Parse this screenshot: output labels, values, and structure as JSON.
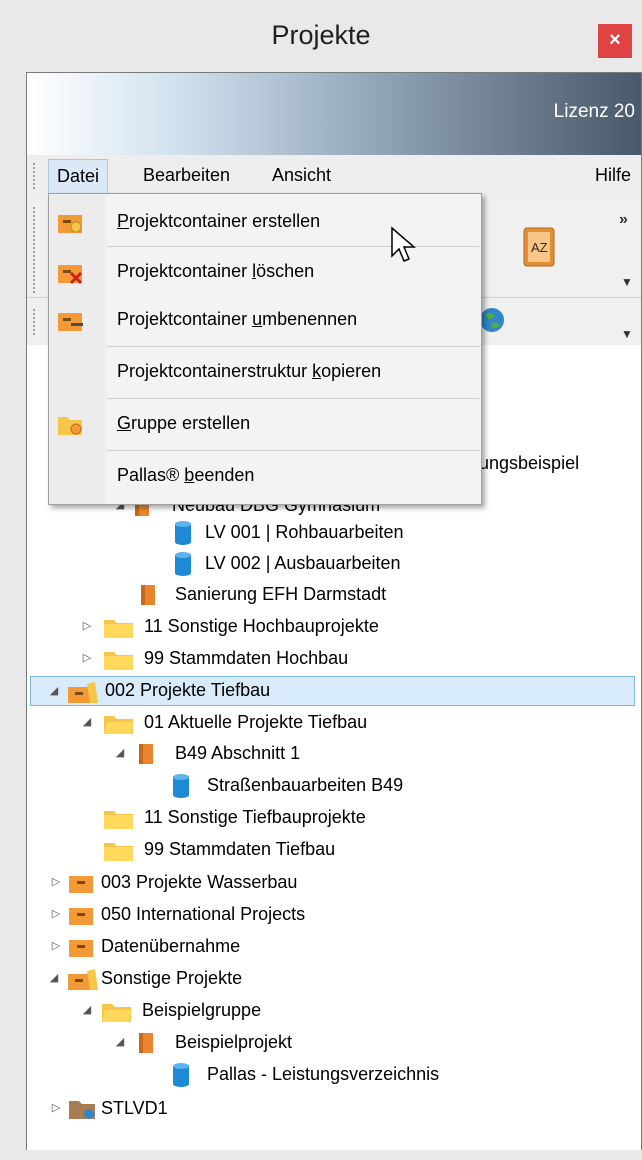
{
  "window": {
    "title": "Projekte",
    "close_label": "×"
  },
  "banner": {
    "license": "Lizenz 20"
  },
  "menubar": {
    "file": "Datei",
    "edit": "Bearbeiten",
    "view": "Ansicht",
    "help": "Hilfe"
  },
  "toolbar": {
    "overflow": "»",
    "az_icon": "AZ"
  },
  "dropdown": {
    "items": [
      {
        "pre": "",
        "u": "P",
        "post": "rojektcontainer erstellen",
        "icon": "folder-add-icon"
      },
      {
        "pre": "Projektcontainer ",
        "u": "l",
        "post": "öschen",
        "icon": "folder-delete-icon"
      },
      {
        "pre": "Projektcontainer ",
        "u": "u",
        "post": "mbenennen",
        "icon": "folder-rename-icon"
      },
      {
        "pre": "Projektcontainerstruktur ",
        "u": "k",
        "post": "opieren",
        "icon": ""
      },
      {
        "pre": "",
        "u": "G",
        "post": "ruppe erstellen",
        "icon": "group-add-icon"
      },
      {
        "pre": "Pallas® ",
        "u": "b",
        "post": "eenden",
        "icon": ""
      }
    ]
  },
  "tree": {
    "partial_right": "ungsbeispiel",
    "partial_row": "Neubau DBG Gymnasium",
    "rows": [
      {
        "label": "LV 001 | Rohbauarbeiten"
      },
      {
        "label": "LV 002 | Ausbauarbeiten"
      },
      {
        "label": "Sanierung EFH Darmstadt"
      },
      {
        "label": "11 Sonstige Hochbauprojekte"
      },
      {
        "label": "99 Stammdaten Hochbau"
      },
      {
        "label": "002 Projekte Tiefbau"
      },
      {
        "label": "01 Aktuelle Projekte Tiefbau"
      },
      {
        "label": "B49 Abschnitt 1"
      },
      {
        "label": "Straßenbauarbeiten B49"
      },
      {
        "label": "11 Sonstige Tiefbauprojekte"
      },
      {
        "label": "99 Stammdaten Tiefbau"
      },
      {
        "label": "003 Projekte Wasserbau"
      },
      {
        "label": "050 International Projects"
      },
      {
        "label": "Datenübernahme"
      },
      {
        "label": "Sonstige Projekte"
      },
      {
        "label": "Beispielgruppe"
      },
      {
        "label": "Beispielprojekt"
      },
      {
        "label": "Pallas - Leistungsverzeichnis"
      },
      {
        "label": "STLVD1"
      }
    ]
  }
}
